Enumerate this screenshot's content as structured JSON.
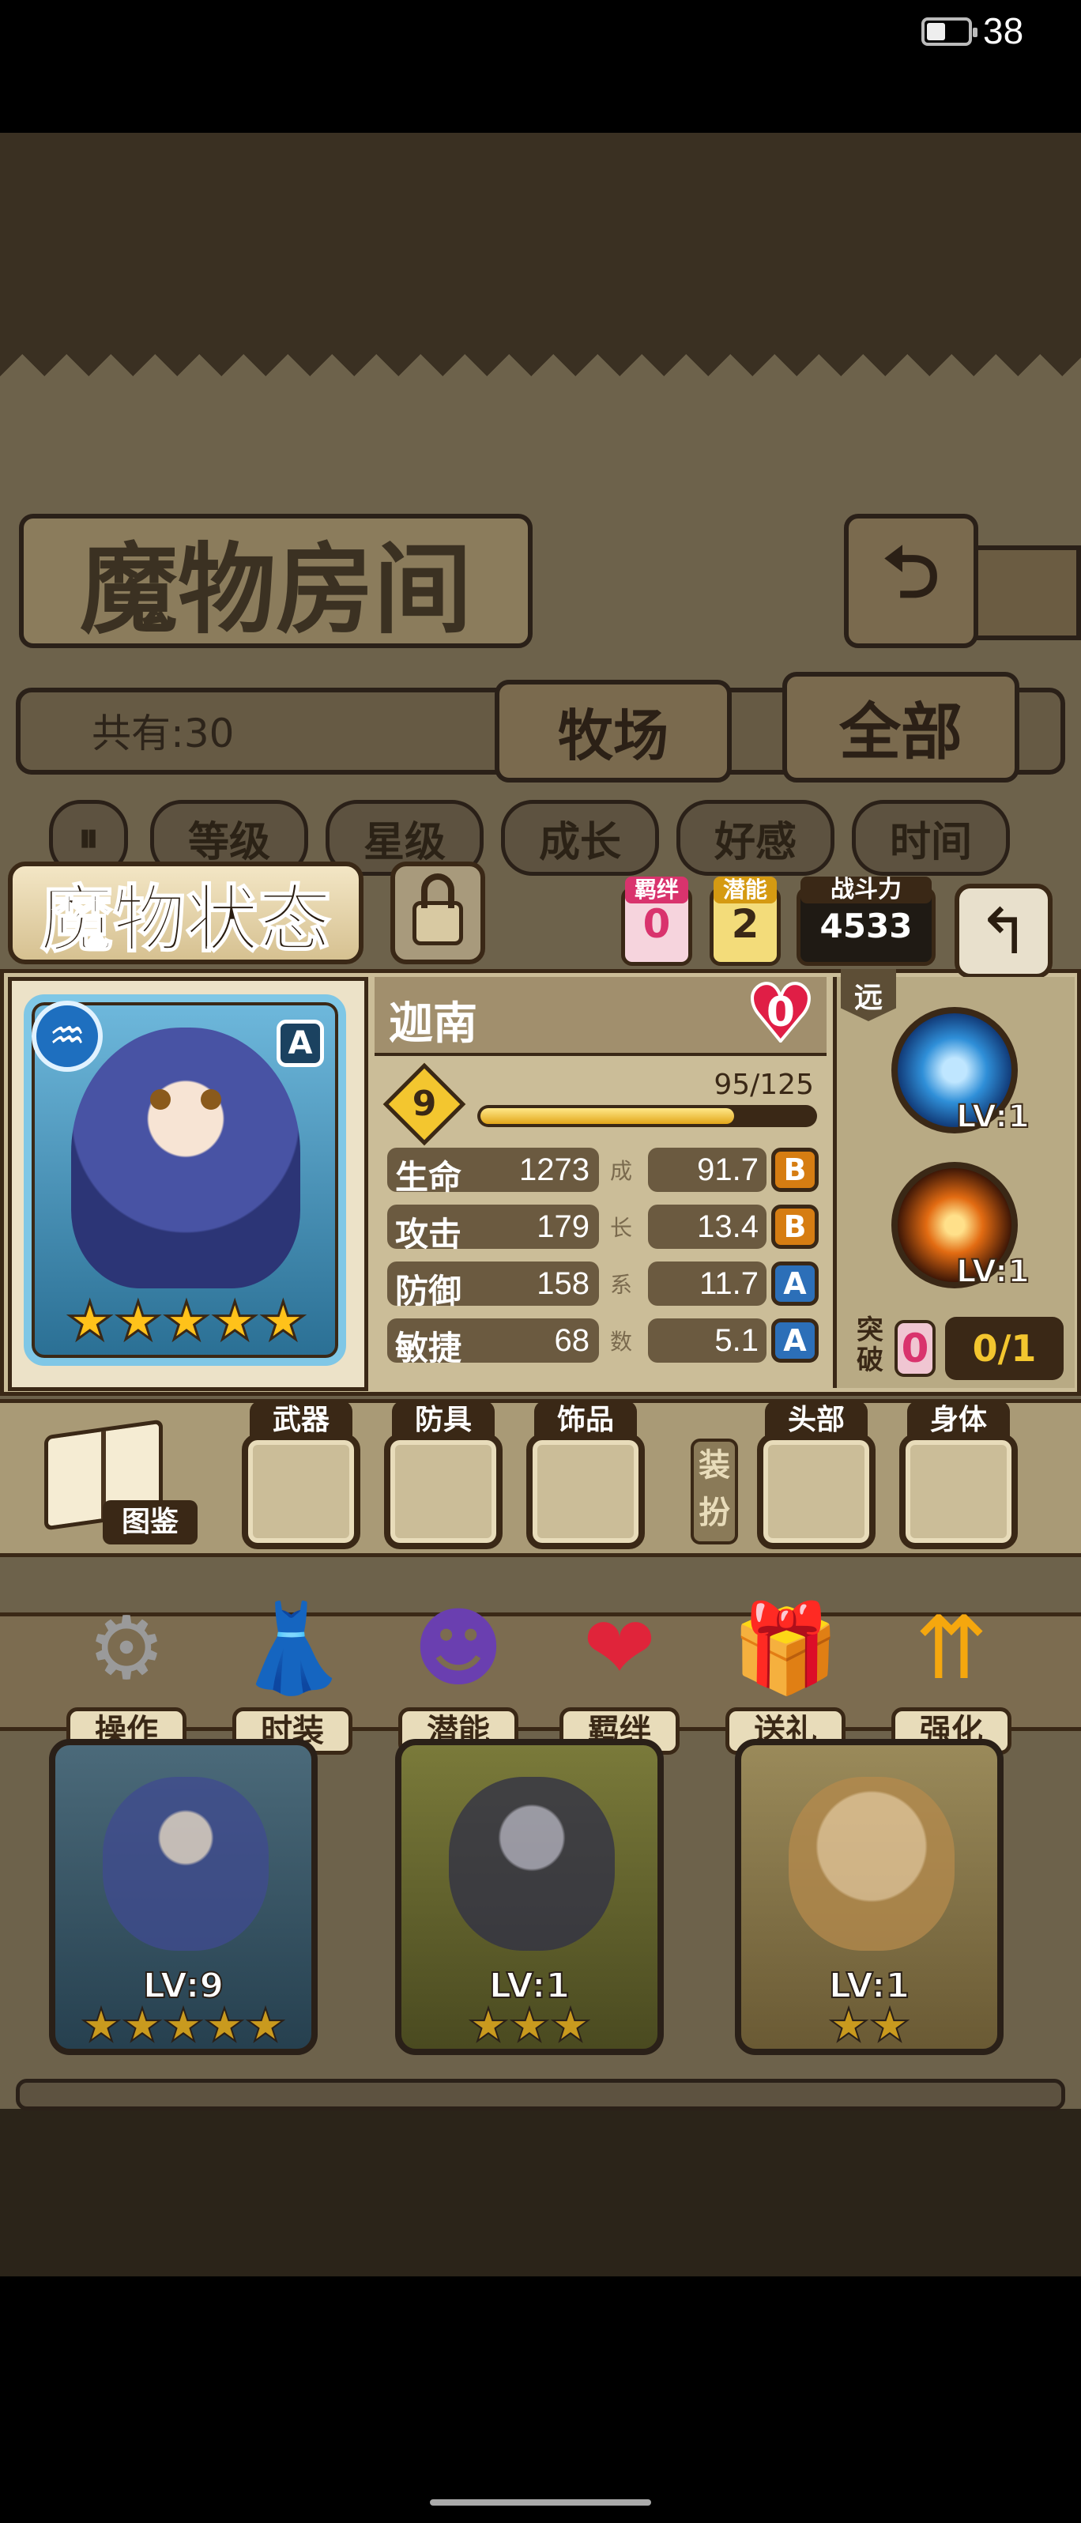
{
  "status_bar": {
    "battery_level": 0.45,
    "battery_text": "38"
  },
  "room": {
    "title": "魔物房间",
    "count_label": "共有:30",
    "tabs": [
      "牧场",
      "全部"
    ],
    "back_icon": "return-arrow-icon"
  },
  "sort": {
    "toggle_icon": "pause-toggle-icon",
    "options": [
      "等级",
      "星级",
      "成长",
      "好感",
      "时间"
    ]
  },
  "status_panel": {
    "title": "魔物状态",
    "lock_icon": "padlock-icon",
    "bond": {
      "label": "羁绊",
      "value": "0"
    },
    "potential": {
      "label": "潜能",
      "value": "2"
    },
    "power": {
      "label": "战斗力",
      "value": "4533"
    },
    "back_icon": "return-arrow-icon"
  },
  "monster": {
    "name": "迦南",
    "element_icon": "water-element-icon",
    "rank": "A",
    "stars": 5,
    "affection": "0",
    "level": "9",
    "xp_text": "95/125",
    "xp_current": 95,
    "xp_max": 125,
    "growth_chars": [
      "成",
      "长",
      "系",
      "数"
    ],
    "stats": [
      {
        "label": "生命",
        "value": "1273",
        "growth": "91.7",
        "grade": "B"
      },
      {
        "label": "攻击",
        "value": "179",
        "growth": "13.4",
        "grade": "B"
      },
      {
        "label": "防御",
        "value": "158",
        "growth": "11.7",
        "grade": "A"
      },
      {
        "label": "敏捷",
        "value": "68",
        "growth": "5.1",
        "grade": "A"
      }
    ]
  },
  "skills": {
    "range_label": "远",
    "items": [
      {
        "icon": "lightning-skill-icon",
        "level": "LV:1"
      },
      {
        "icon": "fire-sword-skill-icon",
        "level": "LV:1"
      }
    ],
    "breakthrough_label": "突破",
    "breakthrough_value": "0",
    "breakthrough_progress": "0/1"
  },
  "equipment": {
    "codex_label": "图鉴",
    "outfit_label": "装扮",
    "slots": [
      "武器",
      "防具",
      "饰品",
      "头部",
      "身体"
    ]
  },
  "actions": [
    {
      "label": "操作",
      "icon": "gear-icon"
    },
    {
      "label": "时装",
      "icon": "dress-icon"
    },
    {
      "label": "潜能",
      "icon": "demon-icon"
    },
    {
      "label": "羁绊",
      "icon": "hearts-icon"
    },
    {
      "label": "送礼",
      "icon": "gift-icon"
    },
    {
      "label": "强化",
      "icon": "up-arrows-icon"
    }
  ],
  "cards": [
    {
      "level": "LV:9",
      "stars": "★★★★★"
    },
    {
      "level": "LV:1",
      "stars": "★★★"
    },
    {
      "level": "LV:1",
      "stars": "★★"
    }
  ],
  "colors": {
    "grade_A": "#2c6fb8",
    "grade_B": "#d67d12",
    "bond": "#d9336d",
    "potential": "#d59a12"
  }
}
